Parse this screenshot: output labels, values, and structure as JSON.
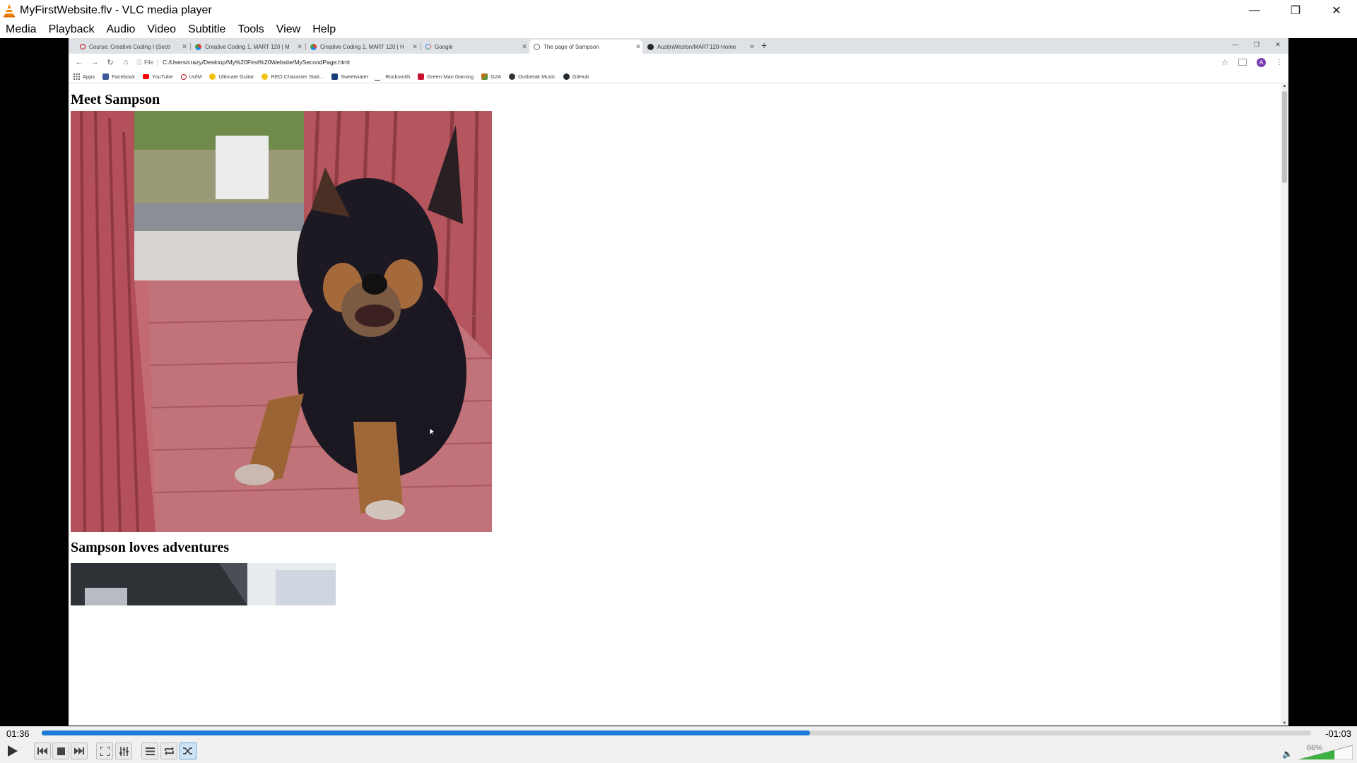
{
  "vlc": {
    "title": "MyFirstWebsite.flv - VLC media player",
    "menu": [
      "Media",
      "Playback",
      "Audio",
      "Video",
      "Subtitle",
      "Tools",
      "View",
      "Help"
    ],
    "time_elapsed": "01:36",
    "time_remaining": "-01:03",
    "progress": 0.605,
    "volume_label": "66%",
    "volume": 0.66,
    "accent": "#1e7ad6"
  },
  "browser": {
    "tabs": [
      {
        "label": "Course: Creative Coding I (Secti",
        "icon": "umaine-power-icon",
        "active": false
      },
      {
        "label": "Creative Coding 1, MART 120 | M",
        "icon": "colored-logo-icon",
        "active": false
      },
      {
        "label": "Creative Coding 1, MART 120 | H",
        "icon": "colored-logo-icon",
        "active": false
      },
      {
        "label": "Google",
        "icon": "google-icon",
        "active": false
      },
      {
        "label": "The page of Sampson",
        "icon": "globe-icon",
        "active": true
      },
      {
        "label": "AustinWeston/MART120-Home",
        "icon": "github-icon",
        "active": false
      }
    ],
    "url_scheme": "File",
    "url": "C:/Users/crazy/Desktop/My%20First%20Website/MySecondPage.html",
    "profile_initial": "A",
    "bookmarks": [
      {
        "label": "Apps",
        "icon": "apps-grid-icon",
        "color": "#4285f4"
      },
      {
        "label": "Facebook",
        "icon": "facebook-icon",
        "color": "#3b5998"
      },
      {
        "label": "YouTube",
        "icon": "youtube-icon",
        "color": "#ff0000"
      },
      {
        "label": "UofM",
        "icon": "power-icon",
        "color": "#b5121b"
      },
      {
        "label": "Ultimate Guitar",
        "icon": "bulb-icon",
        "color": "#f4c20d"
      },
      {
        "label": "REO Character Stati...",
        "icon": "bulb-icon",
        "color": "#f4c20d"
      },
      {
        "label": "Sweetwater",
        "icon": "sweetwater-icon",
        "color": "#1a3e7a"
      },
      {
        "label": "Rocksmith",
        "icon": "rocksmith-icon",
        "color": "#333333"
      },
      {
        "label": "Green Man Gaming",
        "icon": "gmg-icon",
        "color": "#c8102e"
      },
      {
        "label": "G2A",
        "icon": "g2a-icon",
        "color": "#f05f00"
      },
      {
        "label": "Outbreak Music",
        "icon": "disc-icon",
        "color": "#333333"
      },
      {
        "label": "GitHub",
        "icon": "github-icon",
        "color": "#24292e"
      }
    ]
  },
  "page": {
    "heading1": "Meet Sampson",
    "heading2": "Sampson loves adventures"
  }
}
